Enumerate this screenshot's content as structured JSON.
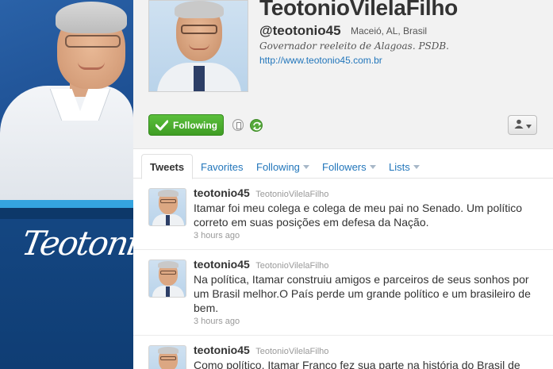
{
  "profile": {
    "full_name": "TeotonioVilelaFilho",
    "screen_name": "@teotonio45",
    "location": "Maceió, AL, Brasil",
    "bio": "Governador reeleito de Alagoas. PSDB.",
    "website": "http://www.teotonio45.com.br"
  },
  "background": {
    "signature_text": "Teotonio"
  },
  "actions": {
    "following_label": "Following"
  },
  "tabs": [
    {
      "label": "Tweets",
      "active": true
    },
    {
      "label": "Favorites",
      "active": false
    },
    {
      "label": "Following",
      "active": false,
      "has_dropdown": true
    },
    {
      "label": "Followers",
      "active": false,
      "has_dropdown": true
    },
    {
      "label": "Lists",
      "active": false,
      "has_dropdown": true
    }
  ],
  "tweets": [
    {
      "screen_name": "teotonio45",
      "full_name": "TeotonioVilelaFilho",
      "text": "Itamar foi meu colega e colega de meu pai no Senado. Um político correto em suas posições em defesa da Nação.",
      "time": "3 hours ago"
    },
    {
      "screen_name": "teotonio45",
      "full_name": "TeotonioVilelaFilho",
      "text": "Na política, Itamar construiu amigos e parceiros de seus sonhos por um Brasil melhor.O País perde um grande político e um brasileiro de bem.",
      "time": "3 hours ago"
    },
    {
      "screen_name": "teotonio45",
      "full_name": "TeotonioVilelaFilho",
      "text": "Como político, Itamar Franco fez sua parte na história do Brasil de",
      "time": ""
    }
  ],
  "colors": {
    "link": "#2276bb",
    "following_green": "#4aab2d",
    "background_blue": "#1b4f8c"
  },
  "icons": [
    "check-icon",
    "device-icon",
    "retweet-icon",
    "user-icon",
    "chevron-down-icon"
  ]
}
